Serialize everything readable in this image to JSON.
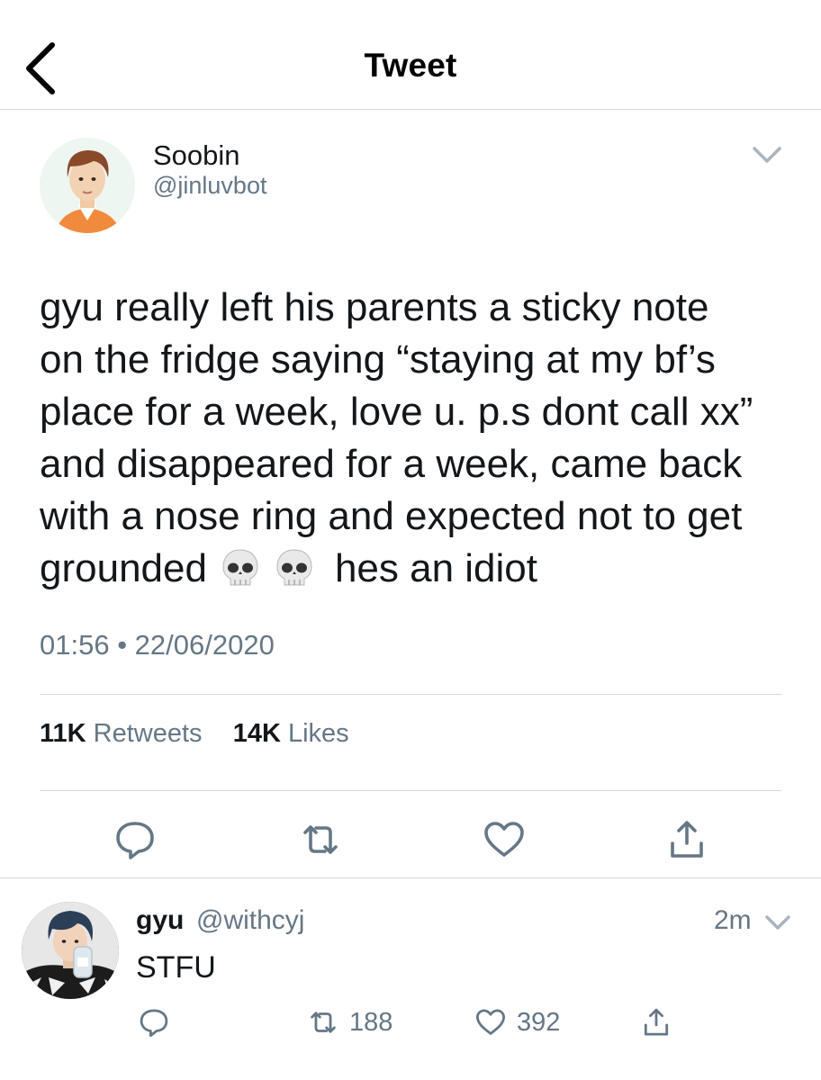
{
  "header": {
    "title": "Tweet",
    "back_icon": "chevron-left-icon"
  },
  "tweet": {
    "author": {
      "display_name": "Soobin",
      "handle": "@jinluvbot"
    },
    "text_lines": [
      "gyu really left his parents a sticky note",
      "on the fridge saying “staying at my bf’s",
      "place for a week, love u. p.s dont call xx”",
      "and disappeared for a week, came back",
      "with a nose ring and expected not to get"
    ],
    "text_last_line_start": "grounded",
    "text_last_line_end": "hes an idiot",
    "emoji": [
      "skull-icon",
      "skull-icon"
    ],
    "timestamp": "01:56 • 22/06/2020",
    "stats": {
      "retweets_count": "11K",
      "retweets_label": "Retweets",
      "likes_count": "14K",
      "likes_label": "Likes"
    },
    "actions": [
      "reply-icon",
      "retweet-icon",
      "like-icon",
      "share-icon"
    ]
  },
  "reply": {
    "display_name": "gyu",
    "handle": "@withcyj",
    "time": "2m",
    "text": "STFU",
    "retweet_count": "188",
    "like_count": "392"
  },
  "colors": {
    "text_primary": "#14171a",
    "text_secondary": "#657786",
    "divider": "#d6d6d6",
    "icon": "#657786"
  }
}
